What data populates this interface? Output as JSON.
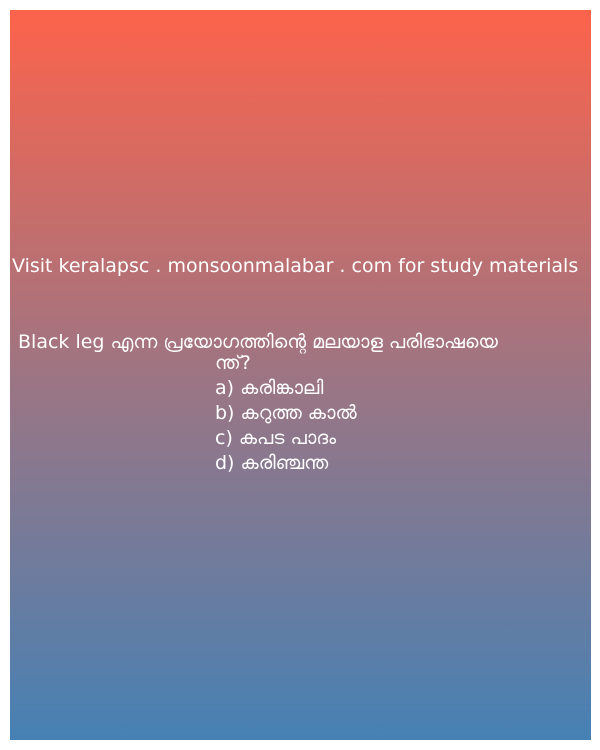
{
  "promo_text": "Visit keralapsc . monsoonmalabar . com for study materials",
  "question": {
    "line1": "Black leg എന്ന പ്രയോഗത്തിന്റെ മലയാള പരിഭാഷയെ",
    "line2": "ന്ത്?"
  },
  "options": [
    "a) കരിങ്കാലി",
    "b) കറുത്ത കാൽ",
    "c) കപട പാദം",
    "d) കരിഞ്ചന്ത"
  ],
  "colors": {
    "gradient_top": "#fd634b",
    "gradient_bottom": "#4681b4",
    "text": "#ffffff"
  }
}
